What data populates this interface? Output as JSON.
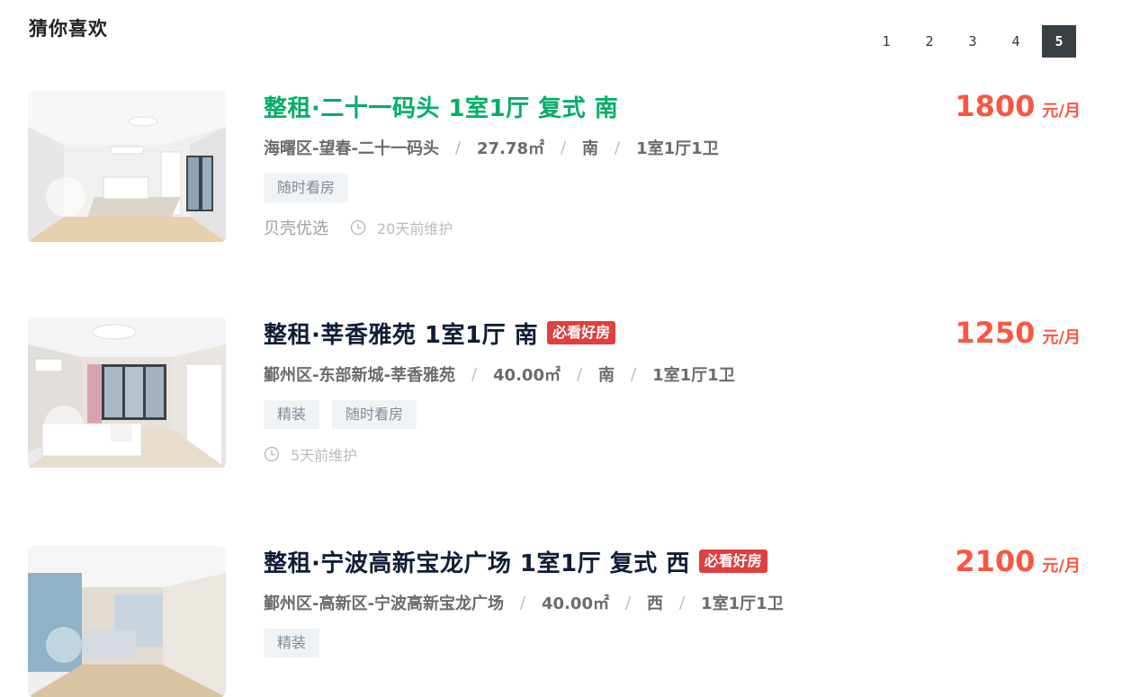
{
  "section_title": "猜你喜欢",
  "pagination": {
    "pages": [
      "1",
      "2",
      "3",
      "4",
      "5"
    ],
    "current": "5"
  },
  "listings": [
    {
      "title": "整租·二十一码头  1室1厅  复式  南",
      "badge": "",
      "location": "海曙区-望春-二十一码头",
      "area": "27.78㎡",
      "orientation": "南",
      "layout": "1室1厅1卫",
      "tags": [
        "随时看房"
      ],
      "brand": "贝壳优选",
      "maintained": "20天前维护",
      "price": "1800",
      "price_unit": "元/月",
      "title_color": "#00ae66"
    },
    {
      "title": "整租·莘香雅苑  1室1厅  南",
      "badge": "必看好房",
      "location": "鄞州区-东部新城-莘香雅苑",
      "area": "40.00㎡",
      "orientation": "南",
      "layout": "1室1厅1卫",
      "tags": [
        "精装",
        "随时看房"
      ],
      "brand": "",
      "maintained": "5天前维护",
      "price": "1250",
      "price_unit": "元/月",
      "title_color": "#101d37"
    },
    {
      "title": "整租·宁波高新宝龙广场  1室1厅  复式  西",
      "badge": "必看好房",
      "location": "鄞州区-高新区-宁波高新宝龙广场",
      "area": "40.00㎡",
      "orientation": "西",
      "layout": "1室1厅1卫",
      "tags": [
        "精装"
      ],
      "brand": "",
      "maintained": "",
      "price": "2100",
      "price_unit": "元/月",
      "title_color": "#101d37"
    }
  ],
  "colors": {
    "accent_green": "#00ae66",
    "price_red": "#fa5741",
    "badge_red": "#e03f3f",
    "pager_active": "#394043"
  },
  "icons": {
    "clock": "clock-icon"
  }
}
